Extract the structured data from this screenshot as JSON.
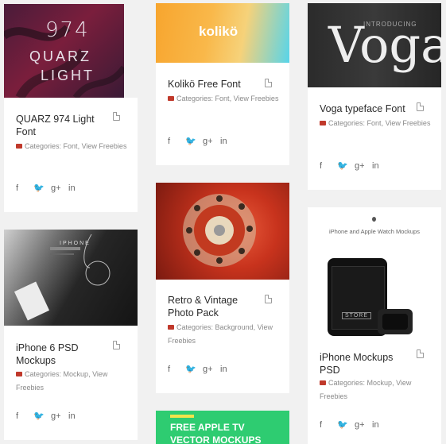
{
  "cards": [
    {
      "title": "QUARZ 974 Light Font",
      "categories_label": "Categories:",
      "category1": "Font",
      "category2": "View Freebies",
      "thumb_text1": "974",
      "thumb_text2": "QUARZ",
      "thumb_text3": "LIGHT"
    },
    {
      "title": "iPhone 6 PSD Mockups",
      "categories_label": "Categories:",
      "category1": "Mockup",
      "category2": "View Freebies",
      "thumb_text1": "IPHONE"
    },
    {
      "title": "Kolikö Free Font",
      "categories_label": "Categories:",
      "category1": "Font",
      "category2": "View Freebies",
      "thumb_text1": "kolikö"
    },
    {
      "title": "Retro & Vintage Photo Pack",
      "categories_label": "Categories:",
      "category1": "Background",
      "category2": "View Freebies"
    },
    {
      "thumb_text1": "FREE APPLE TV",
      "thumb_text2": "VECTOR MOCKUPS"
    },
    {
      "title": "Voga typeface Font",
      "categories_label": "Categories:",
      "category1": "Font",
      "category2": "View Freebies",
      "thumb_text1": "INTRODUCING",
      "thumb_text2": "Voga"
    },
    {
      "title": "iPhone Mockups PSD",
      "categories_label": "Categories:",
      "category1": "Mockup",
      "category2": "View Freebies",
      "thumb_text1": "iPhone and Apple Watch Mockups",
      "thumb_text2": "STORE"
    }
  ],
  "share": {
    "facebook": "f",
    "twitter": "🐦",
    "googleplus": "g+",
    "linkedin": "in"
  }
}
